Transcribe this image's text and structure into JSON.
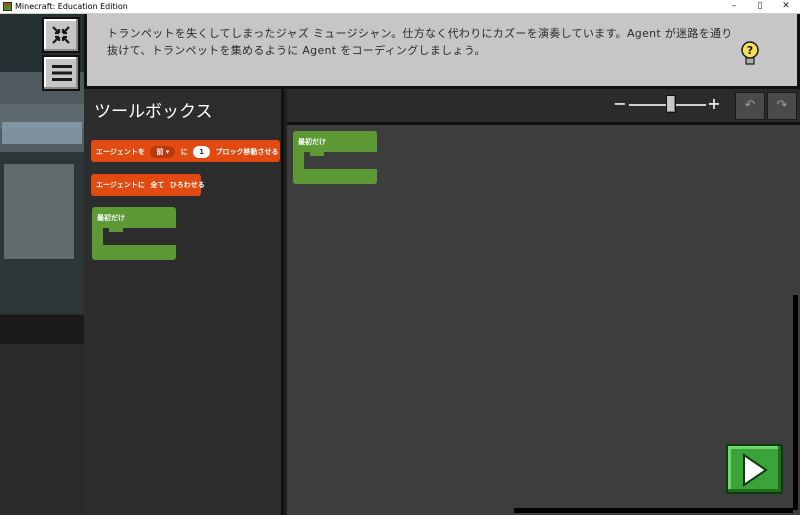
{
  "window": {
    "title": "Minecraft: Education Edition",
    "minimize": "–",
    "maximize": "▯",
    "close": "✕"
  },
  "instruction": {
    "text": "トランペットを失くしてしまったジャズ ミュージシャン。仕方なく代わりにカズーを演奏しています。Agent が迷路を通り抜けて、トランペットを集めるように Agent をコーディングしましょう。"
  },
  "toolbox": {
    "heading": "ツールボックス",
    "blocks": {
      "move_prefix": "エージェントを",
      "move_direction": "前 ▾",
      "move_particle": "に",
      "move_count": "1",
      "move_suffix": "ブロック移動させる",
      "collect_prefix": "エージェントに",
      "collect_all": "全て",
      "collect_suffix": "ひろわせる",
      "on_start": "最初だけ"
    }
  },
  "workspace": {
    "zoom_minus": "−",
    "zoom_plus": "+",
    "zoom_level": 0.55,
    "undo": "↶",
    "redo": "↷",
    "on_start": "最初だけ"
  },
  "colors": {
    "block_orange": "#e14b12",
    "block_green": "#5d9a35",
    "run_green": "#3aa33a",
    "panel_gray": "#c6c6c6"
  },
  "icons": {
    "collapse": "collapse-arrows-icon",
    "menu": "hamburger-icon",
    "hint": "lightbulb-question-icon",
    "run": "play-icon"
  }
}
